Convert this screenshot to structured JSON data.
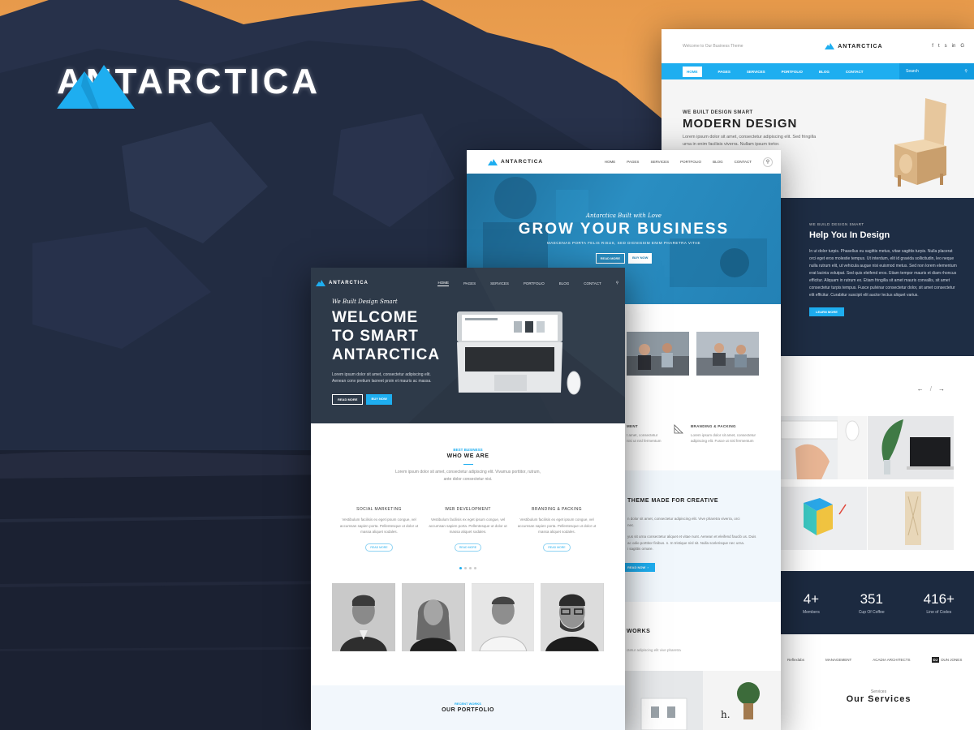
{
  "brand": {
    "name": "ANTARCTICA",
    "accent": "#1eaef0",
    "dark": "#1e2d44"
  },
  "back_page": {
    "tagline": "Welcome to Our Business Theme",
    "brand": "ANTARCTICA",
    "social_icons": [
      "facebook-icon",
      "twitter-icon",
      "skype-icon",
      "linkedin-icon",
      "google-icon"
    ],
    "nav": [
      "HOME",
      "PAGES",
      "SERVICES",
      "PORTFOLIO",
      "BLOG",
      "CONTACT"
    ],
    "search_placeholder": "Search",
    "hero": {
      "subtitle": "WE BUILT DESIGN SMART",
      "title": "MODERN DESIGN",
      "text": "Lorem ipsum dolor sit amet, consectetur adipiscing elit. Sed fringilla urna in enim facilisis viverra. Nullam ipsum tortor.",
      "link": "Lorem ipsum dolor."
    },
    "help": {
      "subtitle": "WE BUILD DESIGN SMART",
      "title": "Help You In Design",
      "text": "In ut dolor turpis. Phasellus eu sagittis metus, vitae sagittis turpis. Nulla placerat orci eget eros molestie tempus. Ut interdum, elit id gravida sollicitudin, leo neque nulla rutrum elit, ut vehicula augue nisi euismod metus. Sed non lorem elementum erat lacinia volutpat. Sed quis eleifend eros. Etiam tempor mauris et diam rhoncus efficitur. Aliquam in rutrum ex. Etiam fringilla sit amet mauris convallis, sit amet consectetur turpis tempus. Fusce pulvinar consectetur dolor, sit amet consectetur elit efficitur. Curabitur suscipit elit auctor lectus aliquet varius.",
      "button": "LEARN MORE"
    },
    "pagination": "/",
    "stats": [
      {
        "num": "4+",
        "label": "Members"
      },
      {
        "num": "351",
        "label": "Cup Of Coffee"
      },
      {
        "num": "416+",
        "label": "Line of Codes"
      }
    ],
    "clients": [
      "Reflexlabs",
      "MANAGEMENT",
      "ACADIA ARCHITECTS",
      "DUN JONES"
    ],
    "services": {
      "subtitle": "Services",
      "title": "Our Services"
    }
  },
  "middle_page": {
    "brand": "ANTARCTICA",
    "nav": [
      "HOME",
      "PAGES",
      "SERVICES",
      "PORTFOLIO",
      "BLOG",
      "CONTACT"
    ],
    "hero": {
      "script": "Antarctica Built with Love",
      "title": "GROW YOUR BUSINESS",
      "tagline": "MAECENAS PORTA FELIS RISUS, SED DIGNISSIM ENIM PHARETRA VITAE",
      "btn_read": "READ MORE",
      "btn_buy": "BUY NOW"
    },
    "services": [
      {
        "title": "MENT",
        "text": "t amet, consectetur\nnisi ut nisl fermentum"
      },
      {
        "title": "BRANDING & PACKING",
        "text": "Lorem ipsum dolor sit amet, consectetur\nadipiscing elit. Fusce ut nisl fermentum"
      }
    ],
    "theme": {
      "title": "THEME MADE FOR CREATIVE",
      "text1": "n dolor sit amet, consectetur adipiscing elit. Vive pharetra viverra, orci\nnec.",
      "text2": "yus sit urna consectetur aliquet et vitae nunt. Aenean et eleifend faucib us. Duis\nac odio porttitor finibus. n. In tristique nisl sit. Nulla scelerisque nec urna.\ni sagittis ornare.",
      "button": "READ NOW"
    },
    "works": {
      "title": "WORKS",
      "text": "ctetur adipiscing elit vive pharetra"
    }
  },
  "front_page": {
    "brand": "ANTARCTICA",
    "nav": [
      "HOME",
      "PAGES",
      "SERVICES",
      "PORTFOLIO",
      "BLOG",
      "CONTACT"
    ],
    "hero": {
      "script": "We Built Design Smart",
      "title_l1": "WELCOME",
      "title_l2": "TO SMART",
      "title_l3": "ANTARCTICA",
      "text": "Lorem ipsum dolor sit amet, consectetur adipiscing elit. Aenean conv pretium laoreet proin et mauris ac massa.",
      "btn_read": "READ MORE",
      "btn_buy": "BUY NOW"
    },
    "who": {
      "subtitle": "BEST BUSINESS",
      "title": "WHO WE ARE",
      "text": "Lorem ipsum dolor sit amet, consectetur adipiscing elit. Vivamus porttitor, rutrum, ante dolor consectetur nisi."
    },
    "columns": [
      {
        "title": "SOCIAL MARKETING",
        "text": "Vestibulum facilisis ex eget ipsum congue, vel accumsan sapien porta. Pellentesque ut dolor ut massa aliquet sodales.",
        "button": "READ MORE"
      },
      {
        "title": "WEB DEVELOPMENT",
        "text": "Vestibulum facilisis ex eget ipsum congue, vel accumsan sapien porta. Pellentesque ut dolor ut massa aliquet sodales.",
        "button": "READ MORE"
      },
      {
        "title": "BRANDING & PACKING",
        "text": "Vestibulum facilisis ex eget ipsum congue, vel accumsan sapien porta. Pellentesque ut dolor ut massa aliquet sodales.",
        "button": "READ MORE"
      }
    ],
    "portfolio": {
      "subtitle": "RECENT WORKS",
      "title": "OUR PORTFOLIO"
    }
  }
}
